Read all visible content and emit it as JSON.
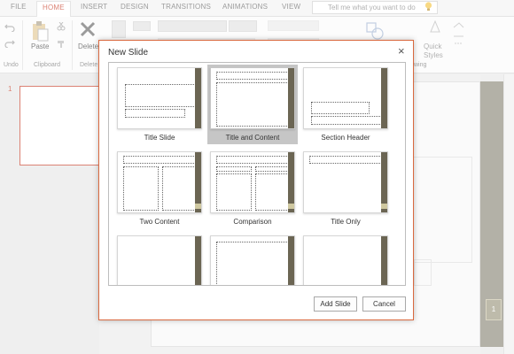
{
  "ribbon_tabs": [
    {
      "label": "FILE",
      "active": false
    },
    {
      "label": "HOME",
      "active": true
    },
    {
      "label": "INSERT",
      "active": false
    },
    {
      "label": "DESIGN",
      "active": false
    },
    {
      "label": "TRANSITIONS",
      "active": false
    },
    {
      "label": "ANIMATIONS",
      "active": false
    },
    {
      "label": "VIEW",
      "active": false
    }
  ],
  "tell_me": {
    "placeholder": "Tell me what you want to do",
    "icon": "lightbulb-icon"
  },
  "ribbon": {
    "undo_group_label": "Undo",
    "clipboard_group_label": "Clipboard",
    "paste_label": "Paste",
    "delete_label": "Delete",
    "delete_group_label": "Delete",
    "drawing_group_label": "wing",
    "quick_styles_label": "Quick Styles"
  },
  "slides_pane": {
    "slide_number": "1"
  },
  "slide_counter_badge": "1",
  "dialog": {
    "title": "New Slide",
    "close_glyph": "×",
    "layouts": [
      {
        "name": "Title Slide",
        "selected": false
      },
      {
        "name": "Title and Content",
        "selected": true
      },
      {
        "name": "Section Header",
        "selected": false
      },
      {
        "name": "Two Content",
        "selected": false
      },
      {
        "name": "Comparison",
        "selected": false
      },
      {
        "name": "Title Only",
        "selected": false
      },
      {
        "name": "",
        "selected": false
      },
      {
        "name": "",
        "selected": false
      },
      {
        "name": "",
        "selected": false
      }
    ],
    "add_button": "Add Slide",
    "cancel_button": "Cancel"
  },
  "colors": {
    "accent": "#c8402a",
    "dialog_border": "#d9693f",
    "theme_strip": "#6b6553",
    "selection": "#c6c6c6"
  }
}
